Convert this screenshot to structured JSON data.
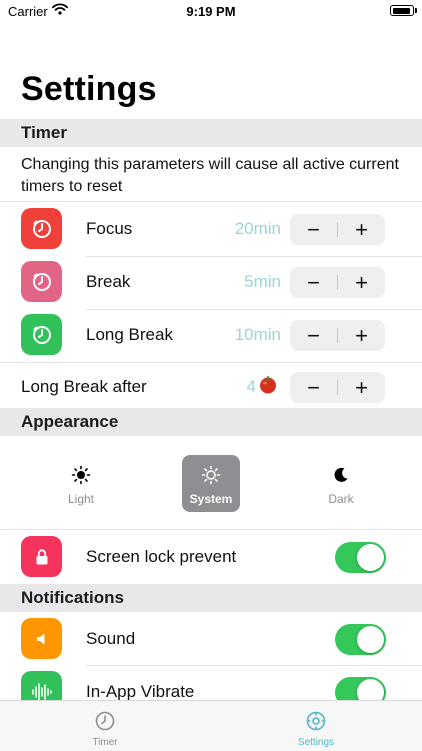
{
  "status_bar": {
    "carrier": "Carrier",
    "time": "9:19 PM"
  },
  "page": {
    "title": "Settings"
  },
  "timer_section": {
    "header": "Timer",
    "note": "Changing this parameters will cause all active current timers to reset",
    "rows": [
      {
        "label": "Focus",
        "value": "20min",
        "icon": "timer-icon",
        "color": "#f0403a"
      },
      {
        "label": "Break",
        "value": "5min",
        "icon": "timer-icon",
        "color": "#e36586"
      },
      {
        "label": "Long Break",
        "value": "10min",
        "icon": "timer-icon",
        "color": "#30c15a"
      }
    ],
    "long_break_after": {
      "label": "Long Break after",
      "value": "4",
      "icon": "tomato-icon"
    },
    "stepper": {
      "minus": "−",
      "plus": "+"
    }
  },
  "appearance_section": {
    "header": "Appearance",
    "options": [
      {
        "label": "Light",
        "icon": "sun-icon",
        "selected": false
      },
      {
        "label": "System",
        "icon": "sun-icon",
        "selected": true
      },
      {
        "label": "Dark",
        "icon": "moon-icon",
        "selected": false
      }
    ],
    "screen_lock": {
      "label": "Screen lock prevent",
      "icon": "lock-icon",
      "color": "#f5345e",
      "enabled": true
    }
  },
  "notifications_section": {
    "header": "Notifications",
    "rows": [
      {
        "label": "Sound",
        "icon": "speaker-icon",
        "color": "#ff9500",
        "enabled": true
      },
      {
        "label": "In-App Vibrate",
        "icon": "vibrate-icon",
        "color": "#30c15a",
        "enabled": true
      }
    ]
  },
  "tab_bar": {
    "tabs": [
      {
        "label": "Timer",
        "icon": "stopwatch-icon",
        "active": false,
        "color": "#8e8e93"
      },
      {
        "label": "Settings",
        "icon": "gear-icon",
        "active": true,
        "color": "#4fb8c8"
      }
    ]
  },
  "colors": {
    "accent": "#4fb8c8",
    "value_text": "#9ed4d4",
    "toggle_on": "#34c759",
    "section_bg": "#e8e8ea"
  }
}
